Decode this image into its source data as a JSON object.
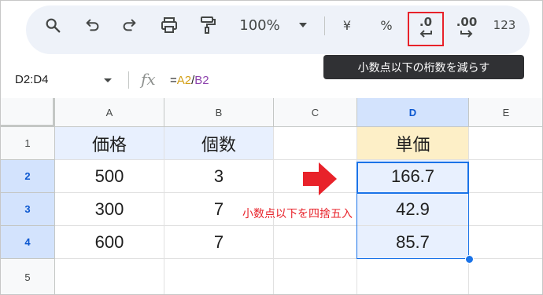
{
  "toolbar": {
    "zoom": "100%",
    "currency": "¥",
    "percent": "%",
    "decrease_decimal": ".0",
    "increase_decimal": ".00",
    "format_more": "123"
  },
  "tooltip": "小数点以下の桁数を減らす",
  "formula_bar": {
    "name_box": "D2:D4",
    "fx": "fx",
    "eq": "=",
    "ref1": "A2",
    "slash": "/",
    "ref2": "B2"
  },
  "columns": [
    "A",
    "B",
    "C",
    "D",
    "E"
  ],
  "rows": [
    "1",
    "2",
    "3",
    "4",
    "5"
  ],
  "cells": {
    "A1": "価格",
    "B1": "個数",
    "D1": "単価",
    "A2": "500",
    "B2": "3",
    "D2": "166.7",
    "A3": "300",
    "B3": "7",
    "D3": "42.9",
    "A4": "600",
    "B4": "7",
    "D4": "85.7"
  },
  "annotation": "小数点以下を四捨五入",
  "colors": {
    "accent": "#1a73e8",
    "highlight": "#e8222a",
    "header_fill": "#e8f0fe",
    "header_yellow": "#fdefc7"
  }
}
